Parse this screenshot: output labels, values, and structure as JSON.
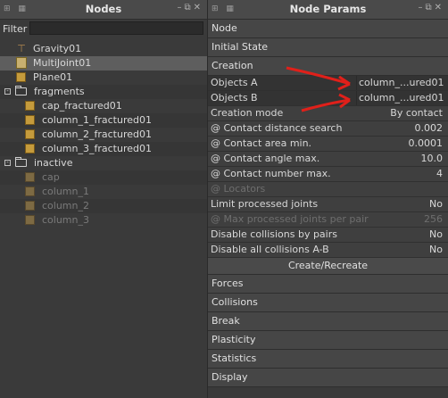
{
  "nodes_panel": {
    "title": "Nodes",
    "filter_label": "Filter",
    "filter_value": "",
    "tree": [
      {
        "label": "Gravity01",
        "icon": "gravity-icon",
        "indent": 1,
        "selected": false,
        "dim": false
      },
      {
        "label": "MultiJoint01",
        "icon": "multijoint-icon",
        "indent": 1,
        "selected": true,
        "dim": false
      },
      {
        "label": "Plane01",
        "icon": "cube-icon",
        "indent": 1,
        "selected": false,
        "dim": false
      },
      {
        "label": "fragments",
        "icon": "folder-icon",
        "indent": 0,
        "selected": false,
        "dim": false,
        "expander": "-"
      },
      {
        "label": "cap_fractured01",
        "icon": "cube-icon",
        "indent": 2,
        "selected": false,
        "dim": false
      },
      {
        "label": "column_1_fractured01",
        "icon": "cube-icon",
        "indent": 2,
        "selected": false,
        "dim": false
      },
      {
        "label": "column_2_fractured01",
        "icon": "cube-icon",
        "indent": 2,
        "selected": false,
        "dim": false
      },
      {
        "label": "column_3_fractured01",
        "icon": "cube-icon",
        "indent": 2,
        "selected": false,
        "dim": false
      },
      {
        "label": "inactive",
        "icon": "folder-icon",
        "indent": 0,
        "selected": false,
        "dim": false,
        "expander": "-"
      },
      {
        "label": "cap",
        "icon": "cube-icon",
        "indent": 2,
        "selected": false,
        "dim": true
      },
      {
        "label": "column_1",
        "icon": "cube-icon",
        "indent": 2,
        "selected": false,
        "dim": true
      },
      {
        "label": "column_2",
        "icon": "cube-icon",
        "indent": 2,
        "selected": false,
        "dim": true
      },
      {
        "label": "column_3",
        "icon": "cube-icon",
        "indent": 2,
        "selected": false,
        "dim": true
      }
    ]
  },
  "params_panel": {
    "title": "Node Params",
    "sections_top": [
      "Node",
      "Initial State",
      "Creation"
    ],
    "rows": [
      {
        "label": "Objects A",
        "value": "column_...ured01",
        "disabled": false,
        "align": "left"
      },
      {
        "label": "Objects B",
        "value": "column_...ured01",
        "disabled": false,
        "align": "left"
      },
      {
        "label": "Creation mode",
        "value": "By contact",
        "disabled": false
      },
      {
        "label": "@ Contact distance search",
        "value": "0.002",
        "disabled": false
      },
      {
        "label": "@ Contact area min.",
        "value": "0.0001",
        "disabled": false
      },
      {
        "label": "@ Contact angle max.",
        "value": "10.0",
        "disabled": false
      },
      {
        "label": "@ Contact number max.",
        "value": "4",
        "disabled": false
      },
      {
        "label": "@ Locators",
        "value": "",
        "disabled": true
      },
      {
        "label": "Limit processed joints",
        "value": "No",
        "disabled": false
      },
      {
        "label": "@ Max processed joints per pair",
        "value": "256",
        "disabled": true
      },
      {
        "label": "Disable collisions by pairs",
        "value": "No",
        "disabled": false
      },
      {
        "label": "Disable all collisions A-B",
        "value": "No",
        "disabled": false
      }
    ],
    "create_button": "Create/Recreate",
    "sections_bottom": [
      "Forces",
      "Collisions",
      "Break",
      "Plasticity",
      "Statistics",
      "Display"
    ]
  },
  "colors": {
    "annotation_arrow": "#e0201a"
  }
}
